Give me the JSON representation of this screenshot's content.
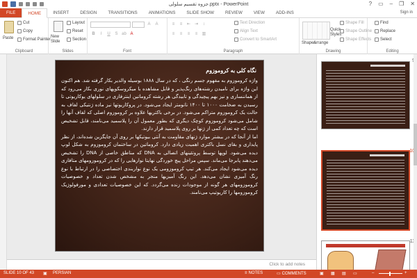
{
  "window": {
    "title": "جزوه تقسیم سلولی.pptx - PowerPoint",
    "controls": [
      "?",
      "▭",
      "–",
      "❐",
      "✕"
    ]
  },
  "ribbon_tabs": [
    "FILE",
    "HOME",
    "INSERT",
    "DESIGN",
    "TRANSITIONS",
    "ANIMATIONS",
    "SLIDE SHOW",
    "REVIEW",
    "VIEW",
    "ADD-INS"
  ],
  "signin_label": "Sign in",
  "clipboard": {
    "paste": "Paste",
    "cut": "Cut",
    "copy": "Copy",
    "format_painter": "Format Painter",
    "label": "Clipboard"
  },
  "slides_group": {
    "new_slide": "New Slide",
    "layout": "Layout",
    "reset": "Reset",
    "section": "Section",
    "label": "Slides"
  },
  "font_group": {
    "label": "Font"
  },
  "paragraph_group": {
    "text_direction": "Text Direction",
    "align_text": "Align Text",
    "convert_smartart": "Convert to SmartArt",
    "label": "Paragraph"
  },
  "drawing_group": {
    "shapes": "Shapes",
    "arrange": "Arrange",
    "quick_styles": "Quick Styles",
    "shape_fill": "Shape Fill",
    "shape_outline": "Shape Outline",
    "shape_effects": "Shape Effects",
    "label": "Drawing"
  },
  "editing_group": {
    "find": "Find",
    "replace": "Replace",
    "select": "Select",
    "label": "Editing"
  },
  "slide": {
    "title": "نگاه کلی به کروموزوم",
    "paragraphs": [
      "واژه کروموزوم به مفهوم جسم رنگی ، که در سال ۱۸۸۸ بوسیله والدیر بکار گرفته شد. هم اکنون این واژه برای نامیدن رشته‌های رنگ‌پذیر و قابل مشاهده با میکروسکوپهای نوری بکار می‌رود که از هماننساری و نیز بهم پیچیدگی و تابیدگی هر رشته کروماتین اینترفازی در سلولهای یوکاریوتی تا رسیدن به ضخامت ۱۰۰۰ تا ۱۴۰۰ نانومتر ایجاد می‌شود. در پروکاریوتها نیز ماده ژنتیکی لفاف به حالت یک کروموزوم متراکم می‌شود. در برخی باکتریها علاوه بر کروموزوم اصلی که لفاف آنها را شامل می‌شود کروموزوم کوچک دیگری که بطور معمول آن را پلاسمید می‌نامند، قابل تشخیص است که چه تعداد کمی از ژنها بر روی پلاسمید قرار دارند.",
      "اما از آنجا که در بیشتر موارد ژنهای مقاومت به آنتی بیوتیکها بر روی آن جایگزین شده‌اند، از نظر پایداری و بقای نسل باکتری اهمیت زیادی دارد. کروماتین در ساختمان کروموزوم به شکل لوپ دیده می‌شود. لوپها توسط پروتئینهای اتصالی به DNA که مناطق خاصی از DNA را تشخیص می‌دهند پابرجا می‌ماند. سپس مراحل پیچ خوردگی نهایتا نوارهایی را که در کروموزومهای متافازی دیده می‌شود ایجاد می‌کند. هر تیپ کروموزومی یک نوع نواربندی اختصاصی را در ارتباط با نوع رنگ آمیزی نشان می‌دهد. این رنگ آمیزیها منجر به مشخص شدن تعداد و خصوصیات کروموزومهای هر گونه از موجودات زنده می‌گردد. که این خصوصیات تعدادی و مورفولوژیک کروموزومها را کاریوتیپ می‌نامند."
    ]
  },
  "notes_placeholder": "Click to add notes",
  "thumbnails": [
    {
      "number": "9",
      "selected": false
    },
    {
      "number": "10",
      "selected": true
    },
    {
      "number": "11",
      "selected": false
    }
  ],
  "status": {
    "slide_position": "SLIDE 10 OF 43",
    "language": "PERSIAN",
    "notes": "NOTES",
    "comments": "COMMENTS"
  },
  "colors": {
    "accent": "#d24726",
    "slide_bg": "#3a1f15"
  }
}
